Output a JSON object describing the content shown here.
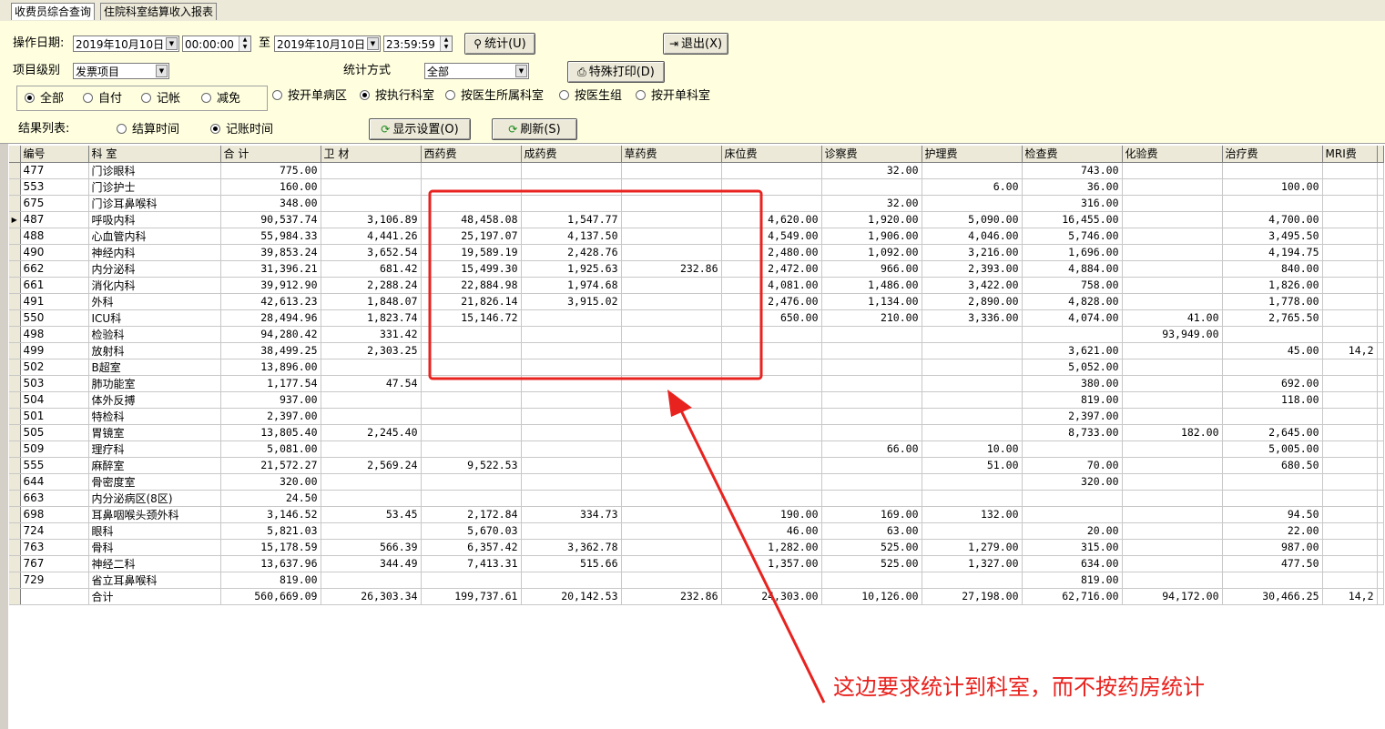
{
  "tabs": [
    "收费员综合查询",
    "住院科室结算收入报表"
  ],
  "filters": {
    "date_label": "操作日期:",
    "start_date": "2019年10月10日",
    "start_time": "00:00:00",
    "to_label": "至",
    "end_date": "2019年10月10日",
    "end_time": "23:59:59",
    "stats_button": "统计(U)",
    "exit_button": "退出(X)",
    "level_label": "项目级别",
    "level_value": "发票项目",
    "method_label": "统计方式",
    "method_value": "全部",
    "print_button": "特殊打印(D)",
    "pay_options": [
      "全部",
      "自付",
      "记帐",
      "减免"
    ],
    "pay_selected": 0,
    "group_options": [
      "按开单病区",
      "按执行科室",
      "按医生所属科室",
      "按医生组",
      "按开单科室"
    ],
    "group_selected": 1,
    "result_label": "结果列表:",
    "time_options": [
      "结算时间",
      "记账时间"
    ],
    "time_selected": 1,
    "display_button": "显示设置(O)",
    "refresh_button": "刷新(S)"
  },
  "table": {
    "headers": [
      "编号",
      "科 室",
      "合 计",
      "卫 材",
      "西药费",
      "成药费",
      "草药费",
      "床位费",
      "诊察费",
      "护理费",
      "检查费",
      "化验费",
      "治疗费",
      "MRI费"
    ],
    "rows": [
      [
        "477",
        "门诊眼科",
        "775.00",
        "",
        "",
        "",
        "",
        "",
        "32.00",
        "",
        "743.00",
        "",
        "",
        ""
      ],
      [
        "553",
        "门诊护士",
        "160.00",
        "",
        "",
        "",
        "",
        "",
        "",
        "6.00",
        "36.00",
        "",
        "100.00",
        ""
      ],
      [
        "675",
        "门诊耳鼻喉科",
        "348.00",
        "",
        "",
        "",
        "",
        "",
        "32.00",
        "",
        "316.00",
        "",
        "",
        ""
      ],
      [
        "487",
        "呼吸内科",
        "90,537.74",
        "3,106.89",
        "48,458.08",
        "1,547.77",
        "",
        "4,620.00",
        "1,920.00",
        "5,090.00",
        "16,455.00",
        "",
        "4,700.00",
        ""
      ],
      [
        "488",
        "心血管内科",
        "55,984.33",
        "4,441.26",
        "25,197.07",
        "4,137.50",
        "",
        "4,549.00",
        "1,906.00",
        "4,046.00",
        "5,746.00",
        "",
        "3,495.50",
        ""
      ],
      [
        "490",
        "神经内科",
        "39,853.24",
        "3,652.54",
        "19,589.19",
        "2,428.76",
        "",
        "2,480.00",
        "1,092.00",
        "3,216.00",
        "1,696.00",
        "",
        "4,194.75",
        ""
      ],
      [
        "662",
        "内分泌科",
        "31,396.21",
        "681.42",
        "15,499.30",
        "1,925.63",
        "232.86",
        "2,472.00",
        "966.00",
        "2,393.00",
        "4,884.00",
        "",
        "840.00",
        ""
      ],
      [
        "661",
        "消化内科",
        "39,912.90",
        "2,288.24",
        "22,884.98",
        "1,974.68",
        "",
        "4,081.00",
        "1,486.00",
        "3,422.00",
        "758.00",
        "",
        "1,826.00",
        ""
      ],
      [
        "491",
        "外科",
        "42,613.23",
        "1,848.07",
        "21,826.14",
        "3,915.02",
        "",
        "2,476.00",
        "1,134.00",
        "2,890.00",
        "4,828.00",
        "",
        "1,778.00",
        ""
      ],
      [
        "550",
        "ICU科",
        "28,494.96",
        "1,823.74",
        "15,146.72",
        "",
        "",
        "650.00",
        "210.00",
        "3,336.00",
        "4,074.00",
        "41.00",
        "2,765.50",
        ""
      ],
      [
        "498",
        "检验科",
        "94,280.42",
        "331.42",
        "",
        "",
        "",
        "",
        "",
        "",
        "",
        "93,949.00",
        "",
        ""
      ],
      [
        "499",
        "放射科",
        "38,499.25",
        "2,303.25",
        "",
        "",
        "",
        "",
        "",
        "",
        "3,621.00",
        "",
        "45.00",
        "14,2"
      ],
      [
        "502",
        "B超室",
        "13,896.00",
        "",
        "",
        "",
        "",
        "",
        "",
        "",
        "5,052.00",
        "",
        "",
        ""
      ],
      [
        "503",
        "肺功能室",
        "1,177.54",
        "47.54",
        "",
        "",
        "",
        "",
        "",
        "",
        "380.00",
        "",
        "692.00",
        ""
      ],
      [
        "504",
        "体外反搏",
        "937.00",
        "",
        "",
        "",
        "",
        "",
        "",
        "",
        "819.00",
        "",
        "118.00",
        ""
      ],
      [
        "501",
        "特检科",
        "2,397.00",
        "",
        "",
        "",
        "",
        "",
        "",
        "",
        "2,397.00",
        "",
        "",
        ""
      ],
      [
        "505",
        "胃镜室",
        "13,805.40",
        "2,245.40",
        "",
        "",
        "",
        "",
        "",
        "",
        "8,733.00",
        "182.00",
        "2,645.00",
        ""
      ],
      [
        "509",
        "理疗科",
        "5,081.00",
        "",
        "",
        "",
        "",
        "",
        "66.00",
        "10.00",
        "",
        "",
        "5,005.00",
        ""
      ],
      [
        "555",
        "麻醉室",
        "21,572.27",
        "2,569.24",
        "9,522.53",
        "",
        "",
        "",
        "",
        "51.00",
        "70.00",
        "",
        "680.50",
        ""
      ],
      [
        "644",
        "骨密度室",
        "320.00",
        "",
        "",
        "",
        "",
        "",
        "",
        "",
        "320.00",
        "",
        "",
        ""
      ],
      [
        "663",
        "内分泌病区(8区)",
        "24.50",
        "",
        "",
        "",
        "",
        "",
        "",
        "",
        "",
        "",
        "",
        ""
      ],
      [
        "698",
        "耳鼻咽喉头颈外科",
        "3,146.52",
        "53.45",
        "2,172.84",
        "334.73",
        "",
        "190.00",
        "169.00",
        "132.00",
        "",
        "",
        "94.50",
        ""
      ],
      [
        "724",
        "眼科",
        "5,821.03",
        "",
        "5,670.03",
        "",
        "",
        "46.00",
        "63.00",
        "",
        "20.00",
        "",
        "22.00",
        ""
      ],
      [
        "763",
        "骨科",
        "15,178.59",
        "566.39",
        "6,357.42",
        "3,362.78",
        "",
        "1,282.00",
        "525.00",
        "1,279.00",
        "315.00",
        "",
        "987.00",
        ""
      ],
      [
        "767",
        "神经二科",
        "13,637.96",
        "344.49",
        "7,413.31",
        "515.66",
        "",
        "1,357.00",
        "525.00",
        "1,327.00",
        "634.00",
        "",
        "477.50",
        ""
      ],
      [
        "729",
        "省立耳鼻喉科",
        "819.00",
        "",
        "",
        "",
        "",
        "",
        "",
        "",
        "819.00",
        "",
        "",
        ""
      ],
      [
        "",
        "合计",
        "560,669.09",
        "26,303.34",
        "199,737.61",
        "20,142.53",
        "232.86",
        "24,303.00",
        "10,126.00",
        "27,198.00",
        "62,716.00",
        "94,172.00",
        "30,466.25",
        "14,2"
      ]
    ],
    "current_row": 3
  },
  "annotation": {
    "text": "这边要求统计到科室，而不按药房统计",
    "color": "#e8231f"
  }
}
